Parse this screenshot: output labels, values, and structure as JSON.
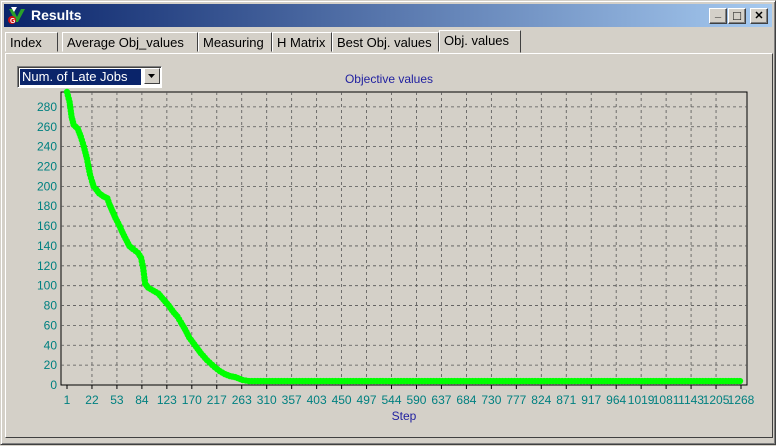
{
  "window": {
    "title": "Results",
    "minimize": "_",
    "maximize": "□",
    "close": "✕"
  },
  "tabs": [
    {
      "label": "Index"
    },
    {
      "label": "Average Obj_values"
    },
    {
      "label": "Measuring"
    },
    {
      "label": "H Matrix"
    },
    {
      "label": "Best Obj. values"
    },
    {
      "label": "Obj. values"
    }
  ],
  "active_tab": 5,
  "selector": {
    "value": "Num. of Late Jobs"
  },
  "colors": {
    "series": "#00ff00",
    "tick_text": "#008080",
    "axis_title": "#1f1fa0",
    "grid": "#555555"
  },
  "chart_data": {
    "type": "scatter",
    "title": "Objective values",
    "xlabel": "Step",
    "ylabel": "",
    "ylim": [
      0,
      295
    ],
    "xlim": [
      1,
      1320
    ],
    "yticks": [
      0,
      20,
      40,
      60,
      80,
      100,
      120,
      140,
      160,
      180,
      200,
      220,
      240,
      260,
      280
    ],
    "xtick_labels": [
      "1",
      "22",
      "53",
      "84",
      "123",
      "170",
      "217",
      "263",
      "310",
      "357",
      "403",
      "450",
      "497",
      "544",
      "590",
      "637",
      "684",
      "730",
      "777",
      "824",
      "871",
      "917",
      "964",
      "1019",
      "1081",
      "1143",
      "1205",
      "1268"
    ],
    "grid": true,
    "series": [
      {
        "name": "",
        "points": [
          [
            1,
            295
          ],
          [
            6,
            285
          ],
          [
            10,
            270
          ],
          [
            14,
            262
          ],
          [
            22,
            258
          ],
          [
            28,
            250
          ],
          [
            34,
            240
          ],
          [
            40,
            228
          ],
          [
            46,
            212
          ],
          [
            50,
            205
          ],
          [
            53,
            200
          ],
          [
            58,
            197
          ],
          [
            64,
            193
          ],
          [
            72,
            190
          ],
          [
            80,
            188
          ],
          [
            84,
            182
          ],
          [
            90,
            175
          ],
          [
            96,
            168
          ],
          [
            104,
            160
          ],
          [
            110,
            153
          ],
          [
            118,
            145
          ],
          [
            123,
            140
          ],
          [
            130,
            137
          ],
          [
            140,
            133
          ],
          [
            146,
            128
          ],
          [
            150,
            118
          ],
          [
            154,
            102
          ],
          [
            160,
            98
          ],
          [
            170,
            95
          ],
          [
            180,
            92
          ],
          [
            190,
            86
          ],
          [
            200,
            80
          ],
          [
            210,
            73
          ],
          [
            217,
            69
          ],
          [
            224,
            63
          ],
          [
            232,
            56
          ],
          [
            240,
            48
          ],
          [
            250,
            41
          ],
          [
            263,
            32
          ],
          [
            275,
            25
          ],
          [
            290,
            18
          ],
          [
            300,
            14
          ],
          [
            310,
            11
          ],
          [
            320,
            9
          ],
          [
            330,
            8
          ],
          [
            345,
            5
          ],
          [
            357,
            4
          ],
          [
            380,
            4
          ],
          [
            403,
            4
          ],
          [
            450,
            4
          ],
          [
            497,
            4
          ],
          [
            544,
            4
          ],
          [
            590,
            4
          ],
          [
            637,
            4
          ],
          [
            684,
            4
          ],
          [
            730,
            4
          ],
          [
            777,
            4
          ],
          [
            824,
            4
          ],
          [
            871,
            4
          ],
          [
            917,
            4
          ],
          [
            964,
            4
          ],
          [
            1019,
            4
          ],
          [
            1081,
            4
          ],
          [
            1143,
            4
          ],
          [
            1205,
            4
          ],
          [
            1268,
            4
          ],
          [
            1318,
            4
          ]
        ]
      }
    ]
  }
}
